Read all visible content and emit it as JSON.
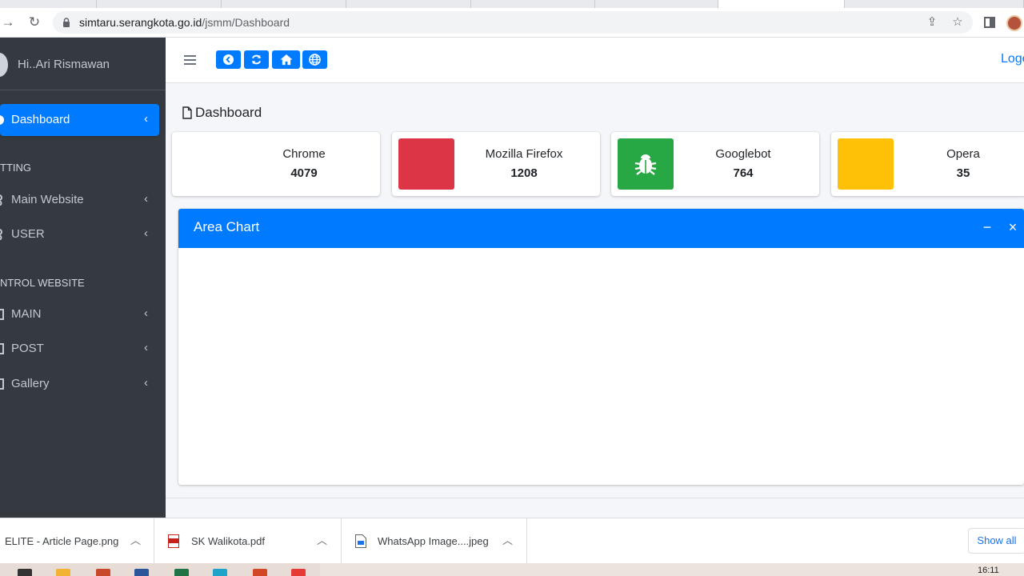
{
  "browser": {
    "url_host": "simtaru.serangkota.go.id",
    "url_path": "/jsmm/Dashboard"
  },
  "sidebar": {
    "user_name": "Hi..Ari Rismawan",
    "items": [
      {
        "label": "Dashboard",
        "active": true
      },
      {
        "label": "Main Website"
      },
      {
        "label": "USER"
      },
      {
        "label": "MAIN"
      },
      {
        "label": "POST"
      },
      {
        "label": "Gallery"
      }
    ],
    "headers": [
      "TTING",
      "NTROL WEBSITE"
    ]
  },
  "topnav": {
    "logout_label": "Logo"
  },
  "main": {
    "page_title": "Dashboard",
    "info_boxes": [
      {
        "label": "Chrome",
        "value": "4079",
        "color": "#ffffff"
      },
      {
        "label": "Mozilla Firefox",
        "value": "1208",
        "color": "#dc3545"
      },
      {
        "label": "Googlebot",
        "value": "764",
        "color": "#28a745"
      },
      {
        "label": "Opera",
        "value": "35",
        "color": "#ffc107"
      }
    ],
    "card": {
      "title": "Area Chart",
      "collapse_symbol": "−",
      "close_symbol": "×"
    }
  },
  "downloads": {
    "items": [
      {
        "name": "ELITE - Article Page.png"
      },
      {
        "name": "SK Walikota.pdf"
      },
      {
        "name": "WhatsApp Image....jpeg"
      }
    ],
    "show_all": "Show all"
  },
  "taskbar": {
    "clock": "16:11"
  },
  "colors": {
    "primary": "#007bff",
    "sidebar": "#343a40",
    "danger": "#dc3545",
    "success": "#28a745",
    "warning": "#ffc107"
  }
}
